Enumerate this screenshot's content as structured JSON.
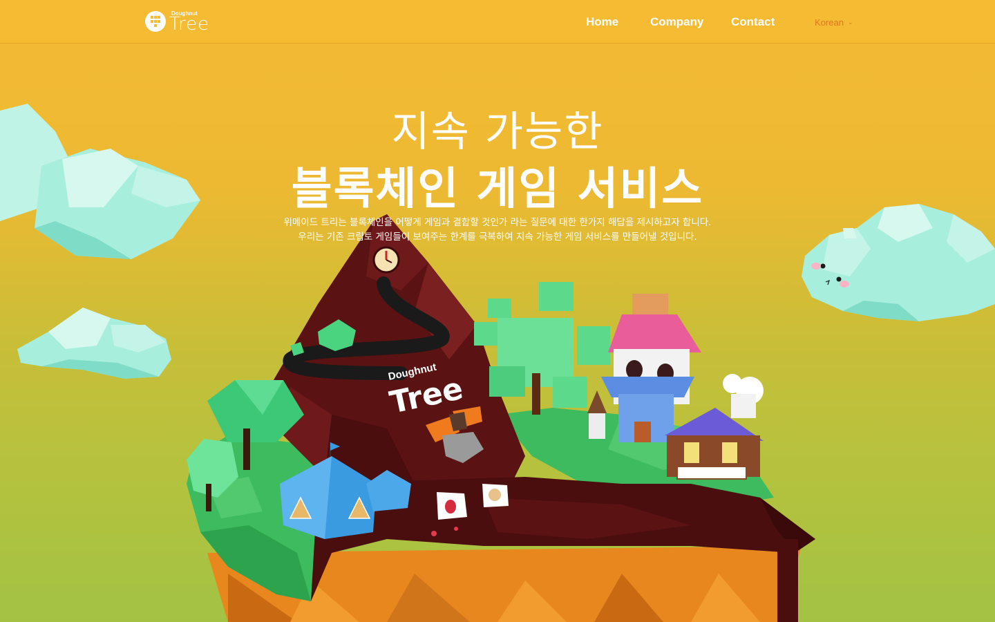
{
  "brand": {
    "logo_sub": "Doughnut",
    "logo_word": "Tree"
  },
  "nav": {
    "items": [
      {
        "label": "Home"
      },
      {
        "label": "Company"
      },
      {
        "label": "Contact"
      }
    ],
    "language": "Korean"
  },
  "hero": {
    "title_line1": "지속 가능한",
    "title_line2": "블록체인 게임 서비스",
    "desc_line1": "위메이드 트리는 블록체인을 어떻게 게임과 결합할 것인가 라는 질문에 대한 한가지 해답을 제시하고자 합니다.",
    "desc_line2": "우리는 기존 크립토 게임들이 보여주는 한계를 극복하여 지속 가능한 게임 서비스를 만들어낼 것입니다."
  },
  "illustration": {
    "sign_sub": "Doughnut",
    "sign_word": "Tree"
  },
  "colors": {
    "header_bg": "#F4BB33",
    "language_text": "#E0761D",
    "mountain": "#5A1212",
    "grass": "#3DBB5E",
    "soil": "#E8871E",
    "cloud": "#9EEEDB"
  }
}
